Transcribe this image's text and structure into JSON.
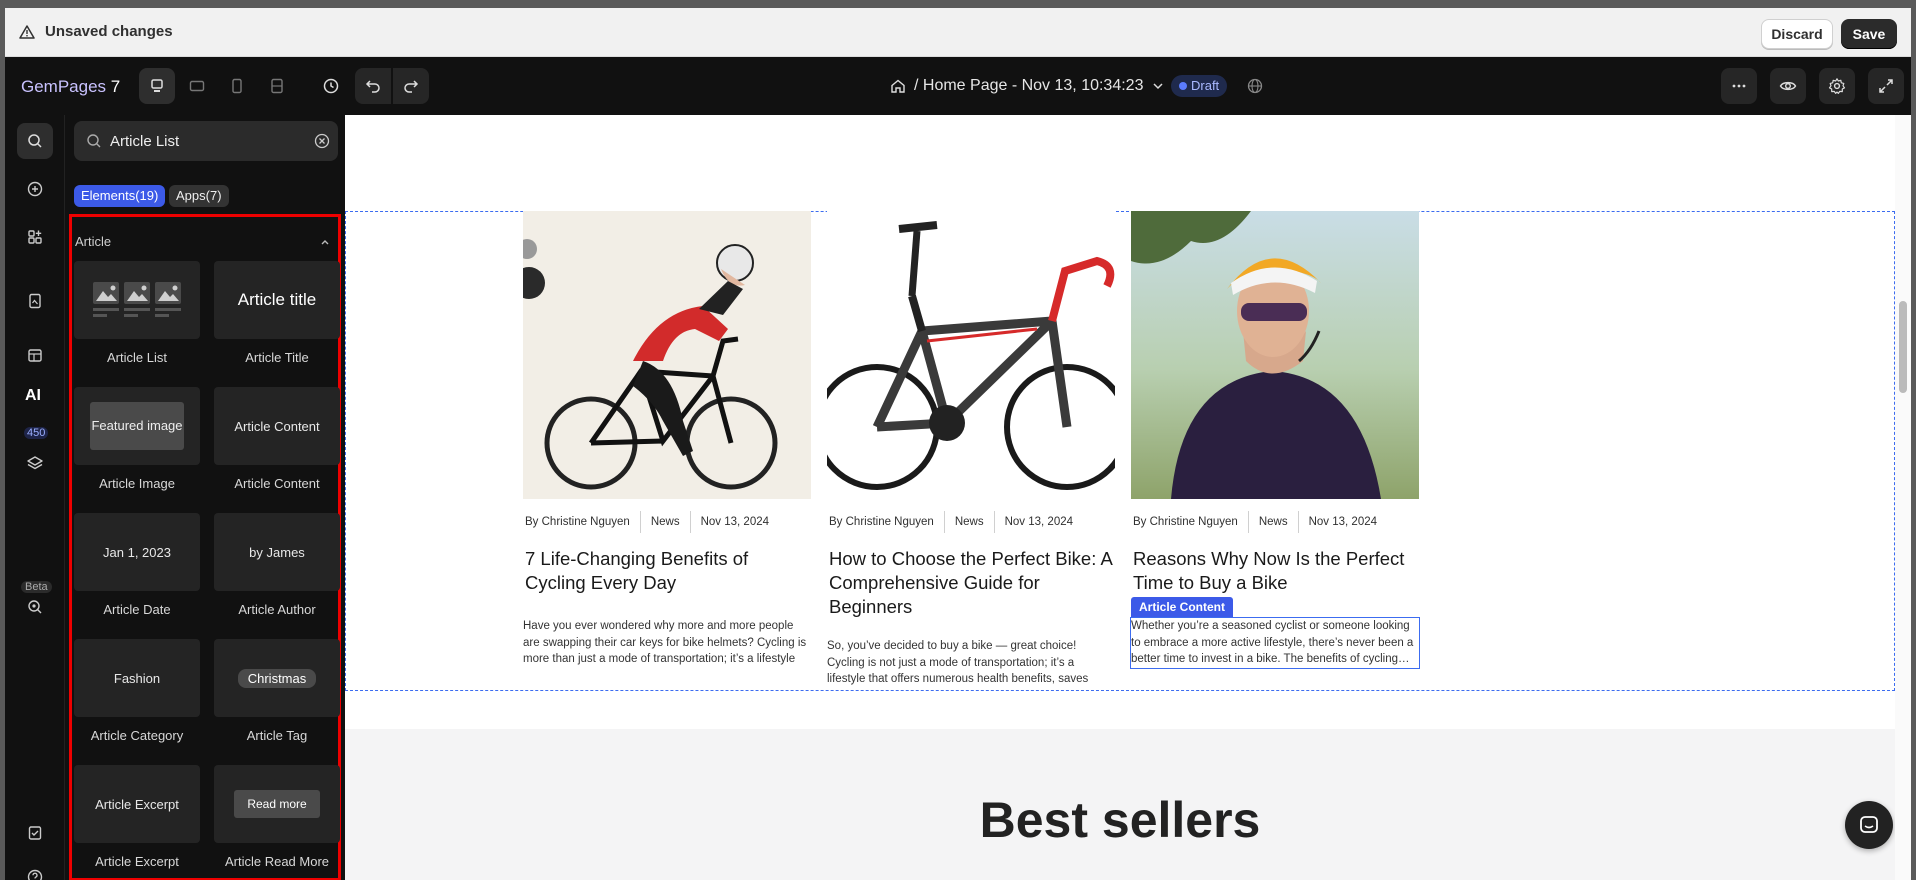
{
  "unsaved_bar": {
    "message": "Unsaved changes",
    "discard_label": "Discard",
    "save_label": "Save"
  },
  "toolbar": {
    "logo_prefix": "GemPages",
    "logo_version": "7",
    "page_title": "/ Home Page - Nov 13, 10:34:23",
    "status_badge": "Draft"
  },
  "rail": {
    "badge_count": "450",
    "ai_label": "AI",
    "beta_label": "Beta"
  },
  "panel": {
    "search_value": "Article List",
    "chip_elements": "Elements(19)",
    "chip_apps": "Apps(7)",
    "section_title": "Article",
    "cards": [
      {
        "preview": "",
        "label": "Article List"
      },
      {
        "preview": "Article title",
        "label": "Article Title"
      },
      {
        "preview": "Featured image",
        "label": "Article Image"
      },
      {
        "preview": "Article Content",
        "label": "Article Content"
      },
      {
        "preview": "Jan 1, 2023",
        "label": "Article Date"
      },
      {
        "preview": "by James",
        "label": "Article Author"
      },
      {
        "preview": "Fashion",
        "label": "Article Category"
      },
      {
        "preview": "Christmas",
        "label": "Article Tag"
      },
      {
        "preview": "Article Excerpt",
        "label": "Article Excerpt"
      },
      {
        "preview": "Read more",
        "label": "Article Read More"
      }
    ]
  },
  "canvas": {
    "articles": [
      {
        "author": "By Christine Nguyen",
        "category": "News",
        "date": "Nov 13, 2024",
        "title": "7 Life-Changing Benefits of Cycling Every Day",
        "excerpt": "Have you ever wondered why more and more people are swapping their car keys for bike helmets? Cycling is more than just a mode of transportation; it’s a lifestyle choice…"
      },
      {
        "author": "By Christine Nguyen",
        "category": "News",
        "date": "Nov 13, 2024",
        "title": "How to Choose the Perfect Bike: A Comprehensive Guide for Beginners",
        "excerpt": "So, you’ve decided to buy a bike — great choice! Cycling is not just a mode of transportation; it’s a lifestyle that offers numerous health benefits, saves money, and helps the…"
      },
      {
        "author": "By Christine Nguyen",
        "category": "News",
        "date": "Nov 13, 2024",
        "title": "Reasons Why Now Is the Perfect Time to Buy a Bike",
        "excerpt": "Whether you’re a seasoned cyclist or someone looking to embrace a more active lifestyle, there’s never been a better time to invest in a bike. The benefits of cycling…"
      }
    ],
    "selection_tag": "Article Content",
    "best_sellers_heading": "Best sellers"
  }
}
